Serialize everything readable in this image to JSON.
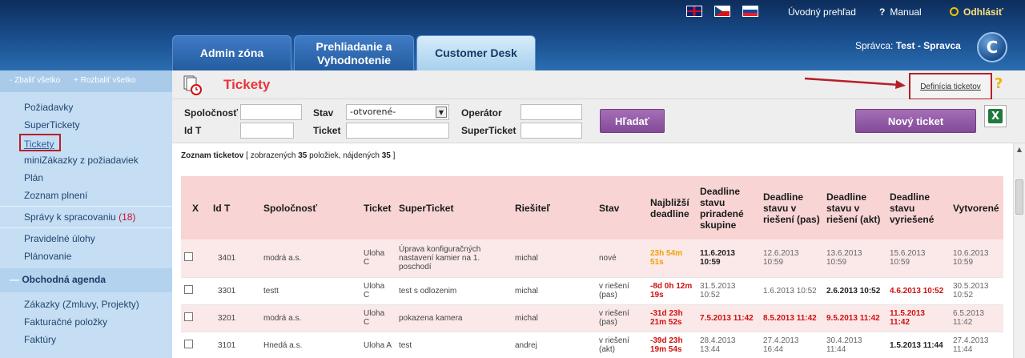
{
  "header": {
    "links": {
      "overview": "Úvodný prehľad",
      "manual": "Manual",
      "logout": "Odhlásiť"
    },
    "tabs": [
      "Admin zóna",
      "Prehliadanie a Vyhodnotenie",
      "Customer Desk"
    ],
    "admin_prefix": "Správca:",
    "admin_name": "Test - Spravca",
    "logo_letter": "C"
  },
  "sidebar": {
    "collapse": "- Zbaliť všetko",
    "expand": "+ Rozbaliť všetko",
    "items": [
      "Požiadavky",
      "SuperTickety",
      "Tickety",
      "miniZákazky z požiadaviek",
      "Plán",
      "Zoznam plnení"
    ],
    "reports_label": "Správy k spracovaniu",
    "reports_count": "(18)",
    "items2": [
      "Pravidelné úlohy",
      "Plánovanie"
    ],
    "section": "Obchodná agenda",
    "items3": [
      "Zákazky (Zmluvy, Projekty)",
      "Fakturačné položky",
      "Faktúry"
    ]
  },
  "page": {
    "title": "Tickety",
    "definition_link": "Definícia ticketov",
    "help": "?"
  },
  "filters": {
    "company_label": "Spoločnosť",
    "id_label": "Id T",
    "state_label": "Stav",
    "state_value": "-otvorené-",
    "ticket_label": "Ticket",
    "operator_label": "Operátor",
    "superticket_label": "SuperTicket",
    "search_button": "Hľadať",
    "new_button": "Nový ticket"
  },
  "list": {
    "title": "Zoznam ticketov",
    "summary_prefix": "[ zobrazených",
    "shown": "35",
    "summary_mid": "položiek, nájdených",
    "found": "35",
    "summary_end": "]"
  },
  "table": {
    "headers": [
      "X",
      "Id T",
      "Spoločnosť",
      "Ticket",
      "SuperTicket",
      "Riešiteľ",
      "Stav",
      "Najbližší deadline",
      "Deadline stavu priradené skupine",
      "Deadline stavu v riešení (pas)",
      "Deadline stavu v riešení (akt)",
      "Deadline stavu vyriešené",
      "Vytvorené"
    ],
    "rows": [
      {
        "id": "3401",
        "company": "modrá a.s.",
        "ticket": "Uloha C",
        "superticket": "Úprava konfiguračných nastavení kamier na 1. poschodí",
        "solver": "michal",
        "state": "nové",
        "deadline": "23h 54m 51s",
        "d1": "11.6.2013 10:59",
        "d2": "12.6.2013 10:59",
        "d3": "13.6.2013 10:59",
        "d4": "15.6.2013 10:59",
        "created": "10.6.2013 10:59"
      },
      {
        "id": "3301",
        "company": "testt",
        "ticket": "Uloha C",
        "superticket": "test s odlozenim",
        "solver": "michal",
        "state": "v riešení (pas)",
        "deadline": "-8d 0h 12m 19s",
        "d1": "31.5.2013 10:52",
        "d2": "1.6.2013 10:52",
        "d3": "2.6.2013 10:52",
        "d4": "4.6.2013 10:52",
        "created": "30.5.2013 10:52"
      },
      {
        "id": "3201",
        "company": "modrá a.s.",
        "ticket": "Uloha C",
        "superticket": "pokazena kamera",
        "solver": "michal",
        "state": "v riešení (pas)",
        "deadline": "-31d 23h 21m 52s",
        "d1": "7.5.2013 11:42",
        "d2": "8.5.2013 11:42",
        "d3": "9.5.2013 11:42",
        "d4": "11.5.2013 11:42",
        "created": "6.5.2013 11:42"
      },
      {
        "id": "3101",
        "company": "Hnedá a.s.",
        "ticket": "Uloha A",
        "superticket": "test",
        "solver": "andrej",
        "state": "v riešení (akt)",
        "deadline": "-39d 23h 19m 54s",
        "d1": "28.4.2013 13:44",
        "d2": "27.4.2013 16:44",
        "d3": "30.4.2013 11:44",
        "d4": "1.5.2013 11:44",
        "created": "27.4.2013 11:44"
      }
    ]
  }
}
